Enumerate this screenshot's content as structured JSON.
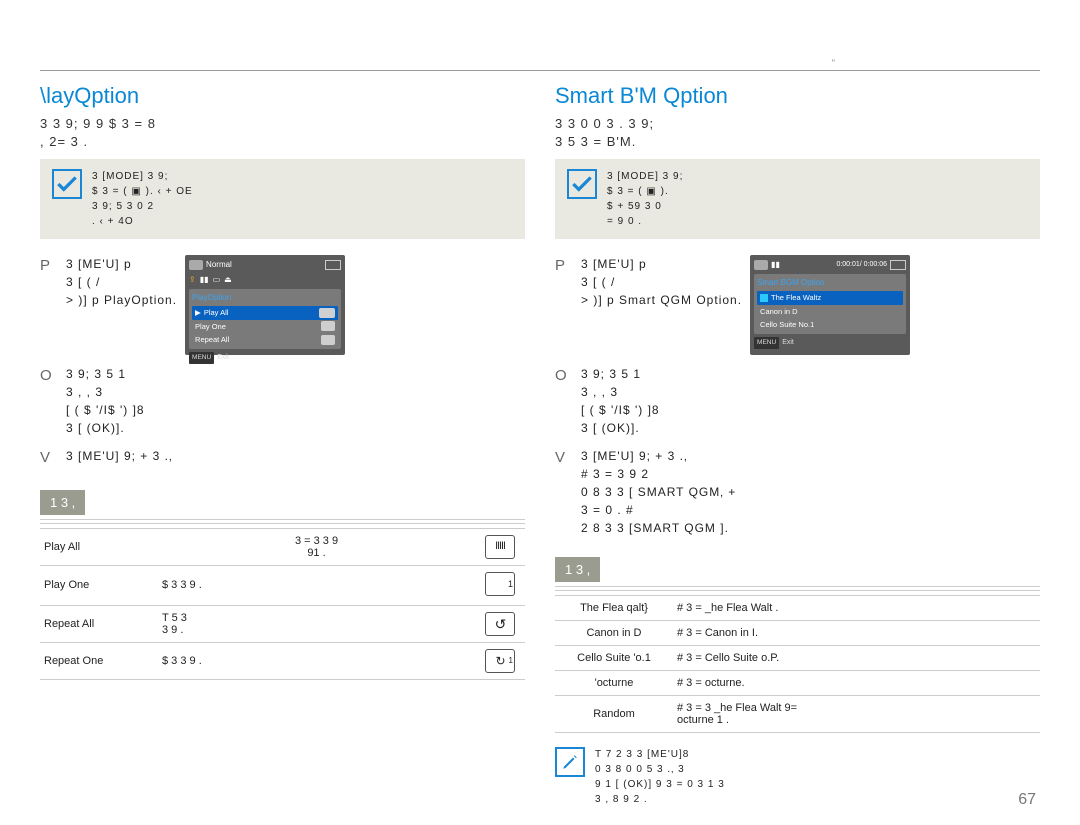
{
  "page_number": "67",
  "top_quote": "\"",
  "left": {
    "heading": "\\layQption",
    "lead": "3      3 9;   9          9     $ 3   = 8\n, 2=       3        .",
    "note": {
      "lines": "            3 [MODE]       3 9;\n$ 3   =  (      ▣   ). ‹   + OE\n3 9;      5 3 0              2\n  .    ‹   + 4O"
    },
    "steps": {
      "p": "        3 [ME'U]         p\n3 [      (    /\n>   )]     p PlayOption.",
      "o": "3 9;     3 5     1\n3    ,      ,      3\n[     ( $ '/I$ ')          ]8\n3 [    (OK)].",
      "v": "        3 [ME'U]   9; + 3    .‚"
    },
    "mini": {
      "normal": "Normal",
      "title": "PlayOption",
      "row_sel": "Play All",
      "rows": [
        "Play One",
        "Repeat All"
      ],
      "exit": "Exit",
      "exit_btn": "MENU"
    },
    "tab": "1   3  ,",
    "table": [
      {
        "name": "Play All",
        "desc": "    3   =  3      3 9\n91        .",
        "glyph": "all"
      },
      {
        "name": "Play One",
        "desc": "$ 3       3 9     .",
        "glyph": "one"
      },
      {
        "name": "Repeat All",
        "desc": "T        5 3\n3 9 .",
        "glyph": "ra"
      },
      {
        "name": "Repeat One",
        "desc": "$ 3       3 9     .",
        "glyph": "ro"
      }
    ]
  },
  "right": {
    "heading": "Smart B'M Qption",
    "lead": "3       3   0     0            3    . 3 9;\n  3 5       3   =  B'M.",
    "note": {
      "lines": "            3 [MODE]       3 9;\n$ 3   =  (      ▣   ).\n$              + 59        3 0\n   = 9   0    ."
    },
    "steps": {
      "p": "        3 [ME'U]         p\n3 [      (    /\n>   )]     p Smart QGM Option.",
      "o": "3 9;     3 5     1\n3    ,      ,      3\n[     ( $ '/I$ ')          ]8\n3 [    (OK)].",
      "v": "        3 [ME'U]   9; + 3    .‚\n  #   3   =      3 9         2\n0    8 3           3 [     SMART QGM‚      +\n3   =       0  . #\n2    8 3           3  [SMART QGM        ]."
    },
    "mini": {
      "time": "0:00:01/ 0:00:06",
      "title": "Smart BGM Option",
      "row_sel": "The Flea Waltz",
      "rows": [
        "Canon in D",
        "Cello Suite No.1"
      ],
      "exit": "Exit",
      "exit_btn": "MENU"
    },
    "tab": "1   3  ,",
    "table": [
      {
        "name": "The Flea qalt}",
        "desc": "#    3   =    _he Flea Walt ."
      },
      {
        "name": "Canon in D",
        "desc": "#    3   =    Canon in I."
      },
      {
        "name": "Cello Suite 'o.1",
        "desc": "#    3   =    Cello Suite  o.P."
      },
      {
        "name": "'octurne",
        "desc": "#    3   =    octurne."
      },
      {
        "name": "Random",
        "desc": "#   3   =  3    _he Flea Walt  9=\nocturne    1       ."
      }
    ],
    "foot_note": {
      "lines": "T       7         2   3          3 [ME'U]8\n0    3      8 0     0   5 3 .‚      3\n 9 1 [      (OK)]   9  3   =    0   3  1 3\n3 , 8       9    2     ."
    }
  }
}
